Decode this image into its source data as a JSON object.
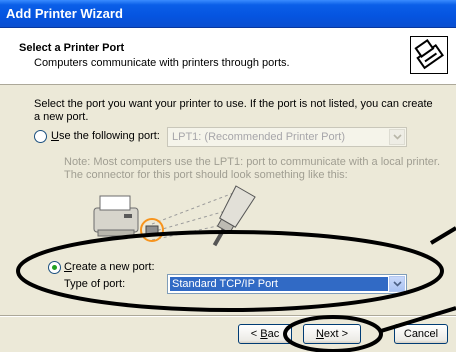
{
  "window": {
    "title": "Add Printer Wizard"
  },
  "header": {
    "title": "Select a Printer Port",
    "subtitle": "Computers communicate with printers through ports.",
    "icon": "printer-icon"
  },
  "intro_text": "Select the port you want your printer to use.  If the port is not listed, you can create a new port.",
  "use_existing": {
    "label_accel": "U",
    "label_rest": "se the following port:",
    "selected": false,
    "port_value": "LPT1: (Recommended Printer Port)"
  },
  "note_text": "Note: Most computers use the LPT1: port to communicate with a local printer. The connector for this port should look something like this:",
  "create_new": {
    "label_accel": "C",
    "label_rest": "reate a new port:",
    "selected": true,
    "type_label": "Type of port:",
    "type_value": "Standard TCP/IP Port"
  },
  "buttons": {
    "back_accel": "B",
    "back_rest": "ac",
    "back_prefix": "< ",
    "next_accel": "N",
    "next_rest": "ext >",
    "cancel": "Cancel"
  },
  "colors": {
    "title_bar": "#0554e0",
    "dialog_bg": "#ece9d8",
    "selection": "#316ac5",
    "highlight_circle": "#f7941d"
  }
}
